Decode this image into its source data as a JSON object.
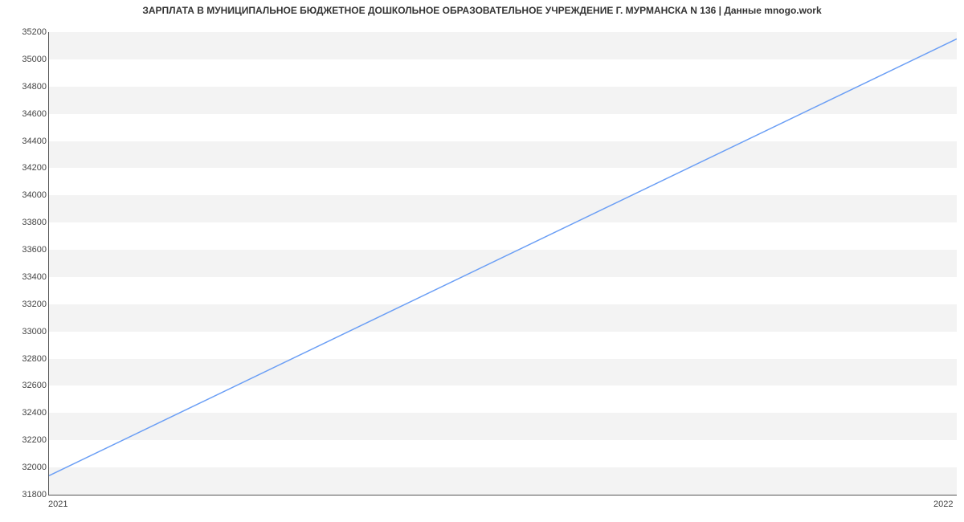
{
  "title": "ЗАРПЛАТА В МУНИЦИПАЛЬНОЕ БЮДЖЕТНОЕ ДОШКОЛЬНОЕ ОБРАЗОВАТЕЛЬНОЕ УЧРЕЖДЕНИЕ Г. МУРМАНСКА N 136 | Данные mnogo.work",
  "chart_data": {
    "type": "line",
    "x": [
      "2021",
      "2022"
    ],
    "values": [
      31940,
      35150
    ],
    "title": "ЗАРПЛАТА В МУНИЦИПАЛЬНОЕ БЮДЖЕТНОЕ ДОШКОЛЬНОЕ ОБРАЗОВАТЕЛЬНОЕ УЧРЕЖДЕНИЕ Г. МУРМАНСКА N 136 | Данные mnogo.work",
    "xlabel": "",
    "ylabel": "",
    "ylim": [
      31800,
      35200
    ],
    "yticks": [
      31800,
      32000,
      32200,
      32400,
      32600,
      32800,
      33000,
      33200,
      33400,
      33600,
      33800,
      34000,
      34200,
      34400,
      34600,
      34800,
      35000,
      35200
    ],
    "xticks": [
      "2021",
      "2022"
    ],
    "line_color": "#6a9ef5"
  }
}
